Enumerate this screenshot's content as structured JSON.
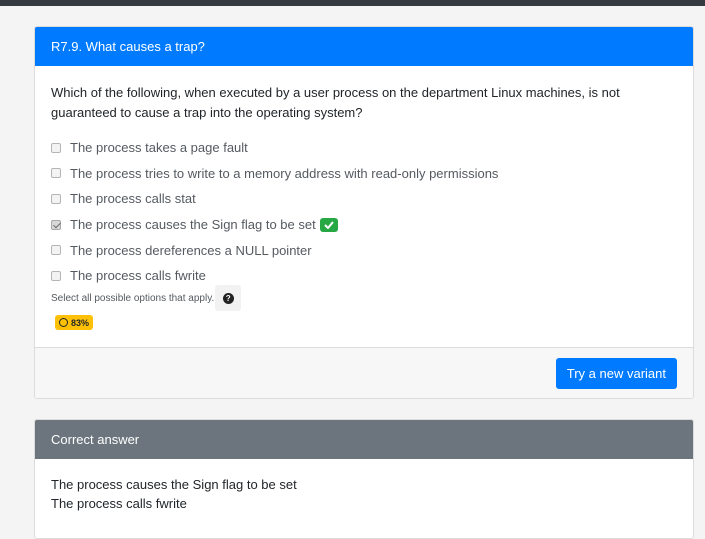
{
  "question_card": {
    "title": "R7.9. What causes a trap?",
    "prompt": "Which of the following, when executed by a user process on the department Linux machines, is not guaranteed to cause a trap into the operating system?",
    "options": [
      {
        "label": "The process takes a page fault",
        "checked": false,
        "marked_correct": false
      },
      {
        "label": "The process tries to write to a memory address with read-only permissions",
        "checked": false,
        "marked_correct": false
      },
      {
        "label": "The process calls stat",
        "checked": false,
        "marked_correct": false
      },
      {
        "label": "The process causes the Sign flag to be set",
        "checked": true,
        "marked_correct": true
      },
      {
        "label": "The process dereferences a NULL pointer",
        "checked": false,
        "marked_correct": false
      },
      {
        "label": "The process calls fwrite",
        "checked": false,
        "marked_correct": false
      }
    ],
    "help_text": "Select all possible options that apply.",
    "help_icon": "question-circle-icon",
    "score": "83%",
    "score_icon": "circle-icon",
    "new_variant_button": "Try a new variant"
  },
  "answer_card": {
    "title": "Correct answer",
    "answers": [
      "The process causes the Sign flag to be set",
      "The process calls fwrite"
    ]
  },
  "colors": {
    "primary": "#007bff",
    "secondary_header": "#6c757d",
    "success": "#28a745",
    "warning": "#ffc107"
  }
}
